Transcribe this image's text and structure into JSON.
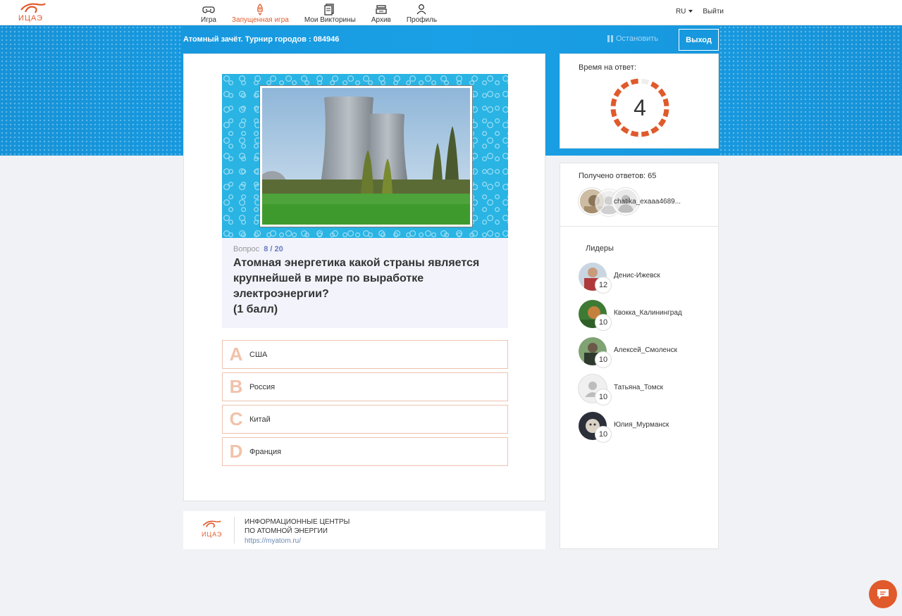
{
  "nav": {
    "logo_text": "ИЦАЭ",
    "tabs": [
      {
        "label": "Игра",
        "icon": "gamepad-icon",
        "active": false
      },
      {
        "label": "Запущенная игра",
        "icon": "rocket-icon",
        "active": true
      },
      {
        "label": "Мои Викторины",
        "icon": "quizzes-icon",
        "active": false
      },
      {
        "label": "Архив",
        "icon": "archive-icon",
        "active": false
      },
      {
        "label": "Профиль",
        "icon": "user-icon",
        "active": false
      }
    ],
    "language": "RU",
    "logout": "Выйти"
  },
  "banner": {
    "game_title": "Атомный зачёт. Турнир городов : 084946",
    "stop_label": "Остановить",
    "exit_label": "Выход"
  },
  "question": {
    "number_label": "Вопрос",
    "current": "8",
    "total": "/ 20",
    "text_lines": [
      "Атомная энергетика какой страны является",
      "крупнейшей в мире по выработке",
      "электроэнергии?",
      "(1 балл)"
    ],
    "answers": [
      {
        "letter": "A",
        "text": "США"
      },
      {
        "letter": "B",
        "text": "Россия"
      },
      {
        "letter": "C",
        "text": "Китай"
      },
      {
        "letter": "D",
        "text": "Франция"
      }
    ]
  },
  "footer": {
    "logo_text": "ИЦАЭ",
    "org_line1": "ИНФОРМАЦИОННЫЕ ЦЕНТРЫ",
    "org_line2": "ПО АТОМНОЙ ЭНЕРГИИ",
    "url": "https://myatom.ru/"
  },
  "timer": {
    "label": "Время на ответ:",
    "seconds": "4"
  },
  "received": {
    "label": "Получено ответов: 65",
    "names_overlay": "chatika_exaaa4689..."
  },
  "leaders": {
    "title": "Лидеры",
    "items": [
      {
        "name": "Денис-Ижевск",
        "score": "12"
      },
      {
        "name": "Квокка_Калининград",
        "score": "10"
      },
      {
        "name": "Алексей_Смоленск",
        "score": "10"
      },
      {
        "name": "Татьяна_Томск",
        "score": "10"
      },
      {
        "name": "Юлия_Мурманск",
        "score": "10"
      }
    ]
  },
  "colors": {
    "accent": "#e05a2b",
    "banner": "#1aa0e6",
    "answer_border": "#edc3ae"
  }
}
